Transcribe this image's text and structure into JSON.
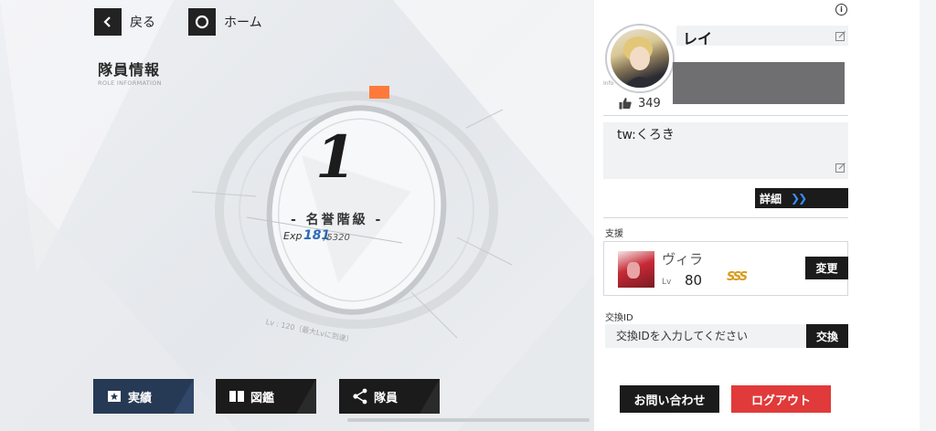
{
  "nav": {
    "back_label": "戻る",
    "home_label": "ホーム"
  },
  "header": {
    "title": "隊員情報",
    "subtitle": "ROLE INFORMATION"
  },
  "rank": {
    "level": "1",
    "name": "- 名誉階級 -",
    "exp_label": "Exp",
    "exp_current": "181",
    "exp_max": "/5320",
    "lv_note": "Lv : 120（最大Lvに到達）"
  },
  "bottom_nav": {
    "records": "実績",
    "pictorial": "図鑑",
    "members": "隊員"
  },
  "profile": {
    "info_label": "Info",
    "name": "レイ",
    "likes": "349",
    "comment": "tw:くろき",
    "detail_label": "詳細",
    "detail_arrows": "❯❯"
  },
  "support": {
    "section_label": "支援",
    "character_name": "ヴィラ",
    "lv_label": "Lv",
    "lv_value": "80",
    "rarity": "SSS",
    "change_label": "変更"
  },
  "exchange": {
    "section_label": "交換ID",
    "placeholder": "交換IDを入力してください",
    "button_label": "交換"
  },
  "footer": {
    "contact_label": "お問い合わせ",
    "logout_label": "ログアウト"
  },
  "colors": {
    "accent_blue": "#2b6cb8",
    "logout_red": "#e03a3a",
    "orange_marker": "#ff7a3a"
  }
}
